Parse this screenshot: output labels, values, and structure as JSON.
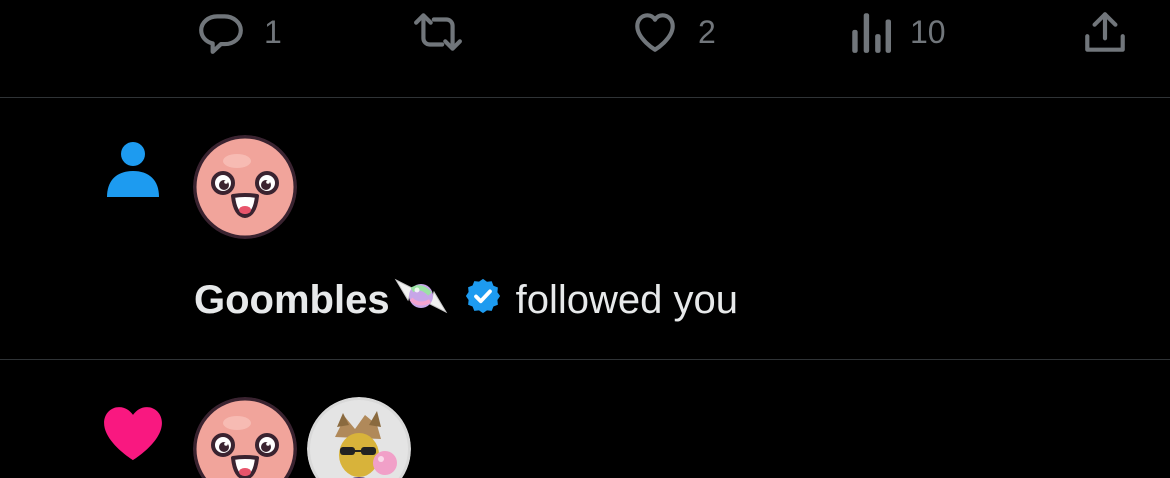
{
  "actions": {
    "reply_count": "1",
    "like_count": "2",
    "views_count": "10"
  },
  "follow_notification": {
    "user_name": "Goombles",
    "action_text": "followed you"
  },
  "colors": {
    "muted": "#71767b",
    "follow_icon": "#1d9bf0",
    "like_icon": "#f91880",
    "verified": "#1d9bf0",
    "divider": "#2f3336"
  }
}
